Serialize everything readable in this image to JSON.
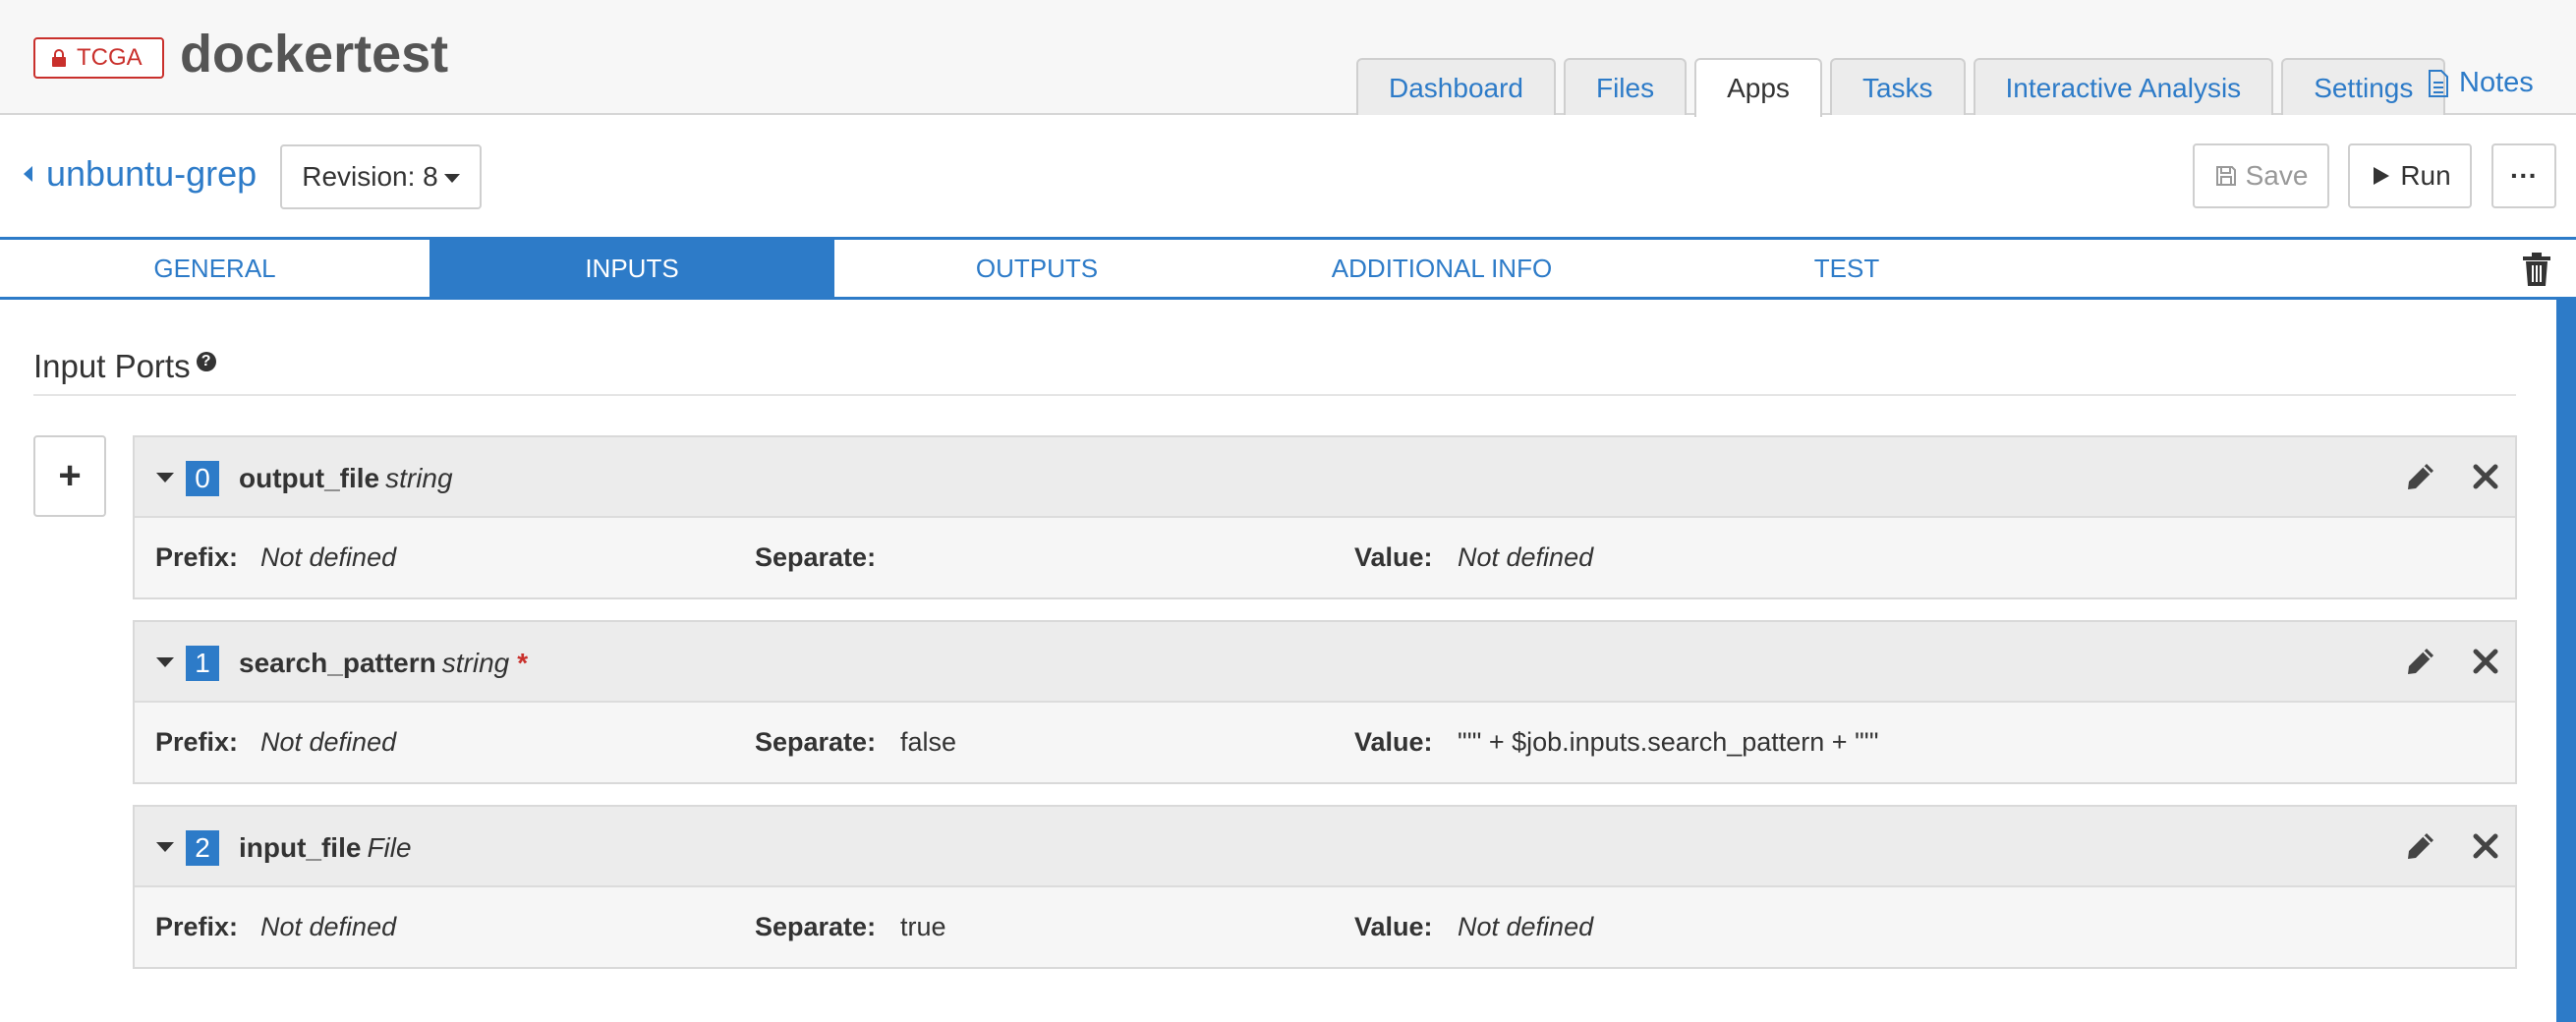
{
  "header": {
    "badge": "TCGA",
    "project_title": "dockertest",
    "tabs": [
      {
        "label": "Dashboard",
        "active": false
      },
      {
        "label": "Files",
        "active": false
      },
      {
        "label": "Apps",
        "active": true
      },
      {
        "label": "Tasks",
        "active": false
      },
      {
        "label": "Interactive Analysis",
        "active": false
      },
      {
        "label": "Settings",
        "active": false
      }
    ],
    "notes": "Notes"
  },
  "appbar": {
    "app_name": "unbuntu-grep",
    "revision": "Revision: 8",
    "save": "Save",
    "run": "Run",
    "more": "···"
  },
  "editor_tabs": [
    {
      "label": "GENERAL",
      "active": false
    },
    {
      "label": "INPUTS",
      "active": true
    },
    {
      "label": "OUTPUTS",
      "active": false
    },
    {
      "label": "ADDITIONAL INFO",
      "active": false
    },
    {
      "label": "TEST",
      "active": false
    }
  ],
  "section": {
    "title": "Input Ports",
    "help": "?",
    "add": "+"
  },
  "field_labels": {
    "prefix": "Prefix:",
    "separate": "Separate:",
    "value": "Value:"
  },
  "ports": [
    {
      "index": "0",
      "name": "output_file",
      "type": "string",
      "required": "",
      "prefix": "Not defined",
      "separate": "",
      "value": "Not defined"
    },
    {
      "index": "1",
      "name": "search_pattern",
      "type": "string",
      "required": "*",
      "prefix": "Not defined",
      "separate": "false",
      "value": "\"'\" + $job.inputs.search_pattern + \"'\""
    },
    {
      "index": "2",
      "name": "input_file",
      "type": "File",
      "required": "",
      "prefix": "Not defined",
      "separate": "true",
      "value": "Not defined"
    }
  ],
  "colors": {
    "accent": "#2d7bc8",
    "danger": "#c9302c"
  },
  "icons": [
    "lock-icon",
    "document-icon",
    "caret-left-icon",
    "caret-down-icon",
    "floppy-icon",
    "play-icon",
    "ellipsis-icon",
    "trash-icon",
    "help-icon",
    "plus-icon",
    "pencil-icon",
    "close-icon"
  ]
}
